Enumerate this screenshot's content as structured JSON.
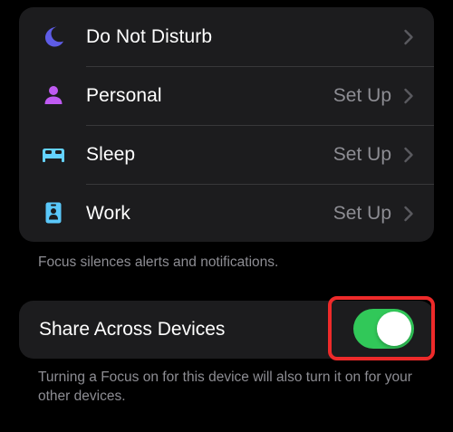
{
  "focus_list": {
    "items": [
      {
        "label": "Do Not Disturb",
        "value": "",
        "icon": "moon-icon",
        "icon_color": "#5e5ce6"
      },
      {
        "label": "Personal",
        "value": "Set Up",
        "icon": "person-icon",
        "icon_color": "#bf5af2"
      },
      {
        "label": "Sleep",
        "value": "Set Up",
        "icon": "bed-icon",
        "icon_color": "#64d2ff"
      },
      {
        "label": "Work",
        "value": "Set Up",
        "icon": "id-badge-icon",
        "icon_color": "#5ac8fa"
      }
    ],
    "footer": "Focus silences alerts and notifications."
  },
  "share": {
    "label": "Share Across Devices",
    "toggle_on": true,
    "toggle_color": "#31c859",
    "highlight_color": "#ee2a2a",
    "footer": "Turning a Focus on for this device will also turn it on for your other devices."
  },
  "colors": {
    "background": "#000000",
    "group_background": "#1c1c1e",
    "secondary_text": "#8d8d93"
  }
}
